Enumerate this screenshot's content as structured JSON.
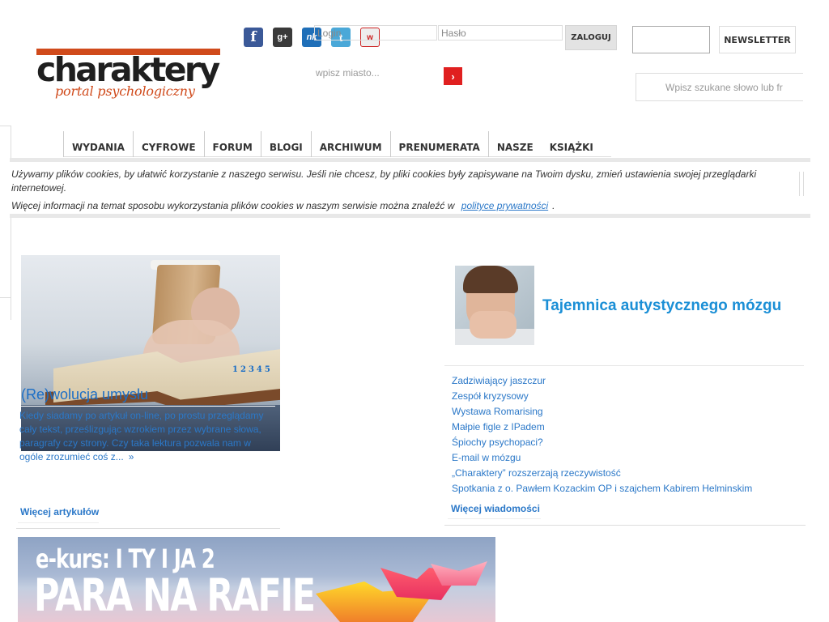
{
  "brand": {
    "name": "charaktery",
    "tagline": "portal psychologiczny"
  },
  "header": {
    "login_placeholder": "Login",
    "password_placeholder": "Hasło",
    "login_button": "ZALOGUJ",
    "newsletter_button": "NEWSLETTER",
    "city_placeholder": "wpisz miasto...",
    "search_placeholder": "Wpisz szukane słowo lub fr"
  },
  "social": [
    {
      "icon": "facebook-icon",
      "glyph": "f"
    },
    {
      "icon": "google-plus-icon",
      "glyph": "g+"
    },
    {
      "icon": "nk-icon",
      "glyph": "nk"
    },
    {
      "icon": "twitter-icon",
      "glyph": "t"
    },
    {
      "icon": "wykop-icon",
      "glyph": "w"
    }
  ],
  "nav": [
    "WYDANIA",
    "CYFROWE",
    "FORUM",
    "BLOGI",
    "ARCHIWUM",
    "PRENUMERATA",
    "NASZE",
    "KSIĄŻKI"
  ],
  "cookie": {
    "line1": "Używamy plików cookies, by ułatwić korzystanie z naszego serwisu. Jeśli nie chcesz, by pliki cookies były zapisywane na Twoim dysku, zmień ustawienia swojej przeglądarki internetowej.",
    "line2": "Więcej informacji na temat sposobu wykorzystania plików cookies w naszym serwisie można znaleźć w",
    "link": "polityce prywatności",
    "end": "."
  },
  "feature": {
    "pages": [
      "1",
      "2",
      "3",
      "4",
      "5"
    ],
    "title": "(Re)wolucja umysłu",
    "text": "Kiedy siadamy po artykuł on-line, po prostu przeglądamy cały tekst, prześlizgując wzrokiem przez wybrane słowa, paragrafy czy strony. Czy taka lektura pozwala nam w ogóle zrozumieć coś z...",
    "more": "»",
    "more_articles": "Więcej artykułów"
  },
  "news": {
    "title": "Tajemnica autystycznego mózgu",
    "items": [
      "Zadziwiający jaszczur",
      "Zespół kryzysowy",
      "Wystawa Romarising",
      "Małpie figle z IPadem",
      "Śpiochy psychopaci?",
      "E-mail w mózgu",
      "„Charaktery” rozszerzają rzeczywistość",
      "Spotkania z o. Pawłem Kozackim OP i szajchem Kabirem Helminskim"
    ],
    "more_news": "Więcej wiadomości"
  },
  "banner": {
    "kicker": "e-kurs: I TY I JA 2",
    "title": "PARA NA RAFIE"
  },
  "colors": {
    "brand_orange": "#d04a1b",
    "link_blue": "#2b78c8",
    "go_red": "#e02020"
  }
}
